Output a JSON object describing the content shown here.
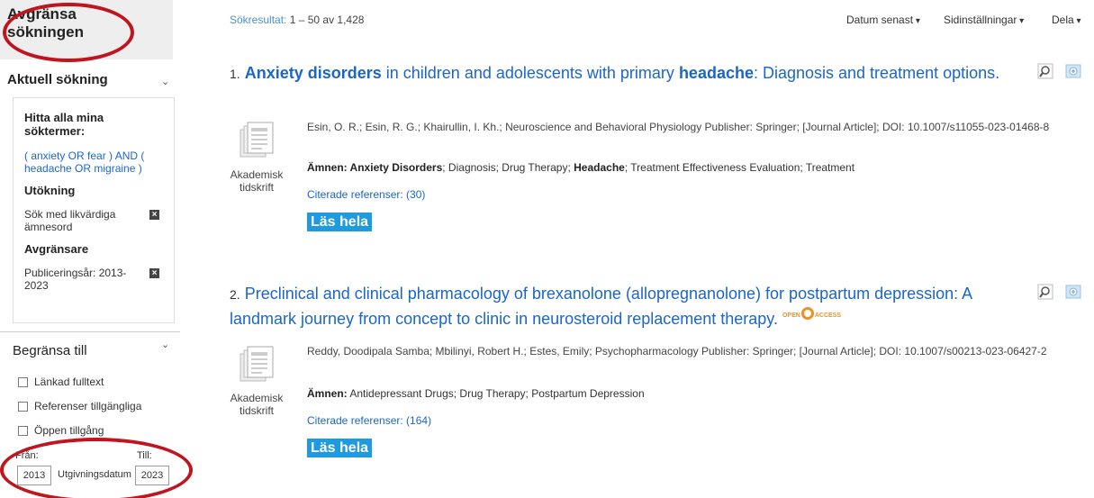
{
  "sidebar": {
    "header": "Avgränsa sökningen",
    "current_search": {
      "title": "Aktuell sökning",
      "find_all": "Hitta alla mina söktermer:",
      "query": "( anxiety OR fear ) AND ( headache OR migraine )",
      "expanders_title": "Utökning",
      "expander": "Sök med likvärdiga ämnesord",
      "limiters_title": "Avgränsare",
      "limiter": "Publiceringsår: 2013-2023"
    },
    "limit_to": {
      "title": "Begränsa till",
      "options": [
        "Länkad fulltext",
        "Referenser tillgängliga",
        "Öppen tillgång"
      ]
    },
    "date": {
      "from_label": "Från:",
      "to_label": "Till:",
      "from_value": "2013",
      "to_value": "2023",
      "field_label": "Utgivningsdatum"
    }
  },
  "toolbar": {
    "results_label": "Sökresultat:",
    "results_count": "1 – 50 av 1,428",
    "sort": "Datum senast",
    "page_options": "Sidinställningar",
    "share": "Dela"
  },
  "results": [
    {
      "number": "1.",
      "title_parts": [
        {
          "t": "Anxiety disorders",
          "b": true
        },
        {
          "t": " in children and adolescents with primary ",
          "b": false
        },
        {
          "t": "headache",
          "b": true
        },
        {
          "t": ": Diagnosis and treatment options.",
          "b": false
        }
      ],
      "meta": "Esin, O. R.; Esin, R. G.; Khairullin, I. Kh.; Neuroscience and Behavioral Physiology Publisher: Springer; [Journal Article]; DOI: 10.1007/s11055-023-01468-8",
      "subjects_label": "Ämnen:",
      "subjects_parts": [
        {
          "t": " Anxiety Disorders",
          "b": true
        },
        {
          "t": "; Diagnosis; Drug Therapy; ",
          "b": false
        },
        {
          "t": "Headache",
          "b": true
        },
        {
          "t": "; Treatment Effectiveness Evaluation; Treatment",
          "b": false
        }
      ],
      "doc_type": "Akademisk tidskrift",
      "cited": "Citerade referenser: (30)",
      "full_text": "Läs hela"
    },
    {
      "number": "2.",
      "title_parts": [
        {
          "t": "Preclinical and clinical pharmacology of brexanolone (allopregnanolone) for postpartum depression: A landmark journey from concept to clinic in neurosteroid replacement therapy.",
          "b": false
        }
      ],
      "open_access": [
        "OPEN",
        "ACCESS"
      ],
      "meta": "Reddy, Doodipala Samba; Mbilinyi, Robert H.; Estes, Emily; Psychopharmacology Publisher: Springer; [Journal Article]; DOI: 10.1007/s00213-023-06427-2",
      "subjects_label": "Ämnen:",
      "subjects_parts": [
        {
          "t": " Antidepressant Drugs; Drug Therapy; Postpartum Depression",
          "b": false
        }
      ],
      "doc_type": "Akademisk tidskrift",
      "cited": "Citerade referenser: (164)",
      "full_text": "Läs hela"
    }
  ],
  "colors": {
    "link": "#1a66c9",
    "fulltext_button": "#1e9be0",
    "annotation": "#c0141e",
    "open_access": "#e8932a"
  }
}
